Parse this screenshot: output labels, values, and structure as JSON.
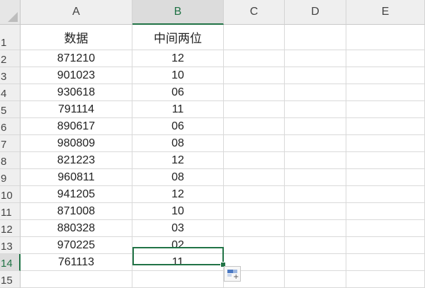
{
  "sheet": {
    "columns": [
      "A",
      "B",
      "C",
      "D",
      "E"
    ],
    "selected_column": "B",
    "rows": [
      {
        "num": "1",
        "a": "数据",
        "b": "中间两位"
      },
      {
        "num": "2",
        "a": "871210",
        "b": "12"
      },
      {
        "num": "3",
        "a": "901023",
        "b": "10"
      },
      {
        "num": "4",
        "a": "930618",
        "b": "06"
      },
      {
        "num": "5",
        "a": "791114",
        "b": "11"
      },
      {
        "num": "6",
        "a": "890617",
        "b": "06"
      },
      {
        "num": "7",
        "a": "980809",
        "b": "08"
      },
      {
        "num": "8",
        "a": "821223",
        "b": "12"
      },
      {
        "num": "9",
        "a": "960811",
        "b": "08"
      },
      {
        "num": "10",
        "a": "941205",
        "b": "12"
      },
      {
        "num": "11",
        "a": "871008",
        "b": "10"
      },
      {
        "num": "12",
        "a": "880328",
        "b": "03"
      },
      {
        "num": "13",
        "a": "970225",
        "b": "02"
      },
      {
        "num": "14",
        "a": "761113",
        "b": "11"
      },
      {
        "num": "15",
        "a": "",
        "b": ""
      }
    ],
    "active_cell": "B14",
    "accent_color": "#217346",
    "header_bg": "#efefef",
    "icons": {
      "select_all": "select-all-triangle-icon",
      "fill_handle": "fill-handle-icon",
      "quick_analysis": "quick-analysis-icon"
    }
  }
}
